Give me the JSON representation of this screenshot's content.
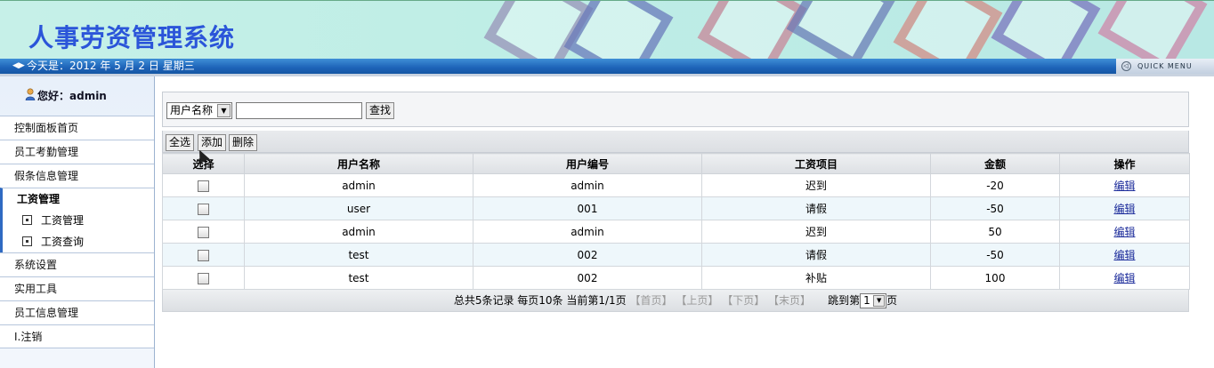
{
  "app": {
    "title": "人事劳资管理系统"
  },
  "datebar": {
    "date_text": "今天是：2012 年 5 月 2 日  星期三",
    "quick_menu": "QUICK MENU"
  },
  "sidebar": {
    "greeting": "您好：admin",
    "items_top": [
      {
        "label": "控制面板首页"
      },
      {
        "label": "员工考勤管理"
      },
      {
        "label": "假条信息管理"
      }
    ],
    "group": {
      "title": "工资管理",
      "subitems": [
        {
          "label": "工资管理"
        },
        {
          "label": "工资查询"
        }
      ]
    },
    "items_bottom": [
      {
        "label": "系统设置"
      },
      {
        "label": "实用工具"
      },
      {
        "label": "员工信息管理"
      },
      {
        "label": "I.注销"
      }
    ]
  },
  "search": {
    "field_selected": "用户名称",
    "input_value": "",
    "button_label": "查找"
  },
  "toolbar": {
    "select_all": "全选",
    "add": "添加",
    "delete": "删除"
  },
  "table": {
    "headers": [
      "选择",
      "用户名称",
      "用户编号",
      "工资项目",
      "金额",
      "操作"
    ],
    "rows": [
      {
        "name": "admin",
        "id": "admin",
        "item": "迟到",
        "amount": "-20",
        "action": "编辑"
      },
      {
        "name": "user",
        "id": "001",
        "item": "请假",
        "amount": "-50",
        "action": "编辑"
      },
      {
        "name": "admin",
        "id": "admin",
        "item": "迟到",
        "amount": "50",
        "action": "编辑"
      },
      {
        "name": "test",
        "id": "002",
        "item": "请假",
        "amount": "-50",
        "action": "编辑"
      },
      {
        "name": "test",
        "id": "002",
        "item": "补贴",
        "amount": "100",
        "action": "编辑"
      }
    ]
  },
  "pager": {
    "summary": "总共5条记录 每页10条 当前第1/1页",
    "first": "【首页】",
    "prev": "【上页】",
    "next": "【下页】",
    "last": "【末页】",
    "jump_prefix": "跳到第",
    "page_value": "1",
    "jump_suffix": "页"
  }
}
